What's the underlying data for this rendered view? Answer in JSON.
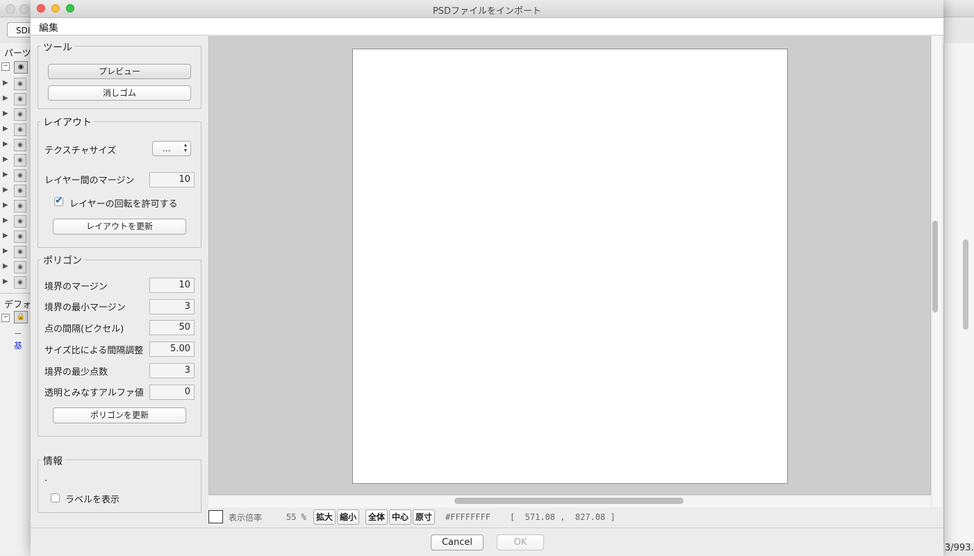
{
  "background_app": {
    "toolbar_button": "SDI",
    "panel_tab_parts": "パーツ",
    "panel_tab_default": "デフォ",
    "tree_item": "－ 基",
    "status_right": "3/993."
  },
  "dialog": {
    "title": "PSDファイルをインポート",
    "menu": {
      "edit": "編集"
    },
    "tools": {
      "title": "ツール",
      "preview_button": "プレビュー",
      "eraser_button": "消しゴム"
    },
    "layout": {
      "title": "レイアウト",
      "texture_size_label": "テクスチャサイズ",
      "texture_size_value": "...",
      "layer_margin_label": "レイヤー間のマージン",
      "layer_margin_value": "10",
      "allow_rotation_label": "レイヤーの回転を許可する",
      "allow_rotation_checked": true,
      "update_button": "レイアウトを更新"
    },
    "polygon": {
      "title": "ポリゴン",
      "fields": [
        {
          "label": "境界のマージン",
          "value": "10"
        },
        {
          "label": "境界の最小マージン",
          "value": "3"
        },
        {
          "label": "点の間隔(ピクセル)",
          "value": "50"
        },
        {
          "label": "サイズ比による間隔調整",
          "value": "5.00"
        },
        {
          "label": "境界の最少点数",
          "value": "3"
        },
        {
          "label": "透明とみなすアルファ値",
          "value": "0"
        }
      ],
      "update_button": "ポリゴンを更新"
    },
    "info": {
      "title": "情報",
      "text": ".",
      "show_label_label": "ラベルを表示",
      "show_label_checked": false
    },
    "status": {
      "zoom_label": "表示倍率",
      "zoom_value": "55 %",
      "zoom_in": "拡大",
      "zoom_out": "縮小",
      "fit_all": "全体",
      "center": "中心",
      "actual_size": "原寸",
      "color_value": "#FFFFFFFF",
      "coords": "[  571.08 ,  827.08 ]"
    },
    "footer": {
      "cancel": "Cancel",
      "ok": "OK"
    }
  },
  "colors": {
    "close": "#fc605b",
    "minimize": "#fdbc40",
    "maximize": "#34c84a",
    "canvas": "#ffffff",
    "preview_background": "#cdcdcd"
  }
}
